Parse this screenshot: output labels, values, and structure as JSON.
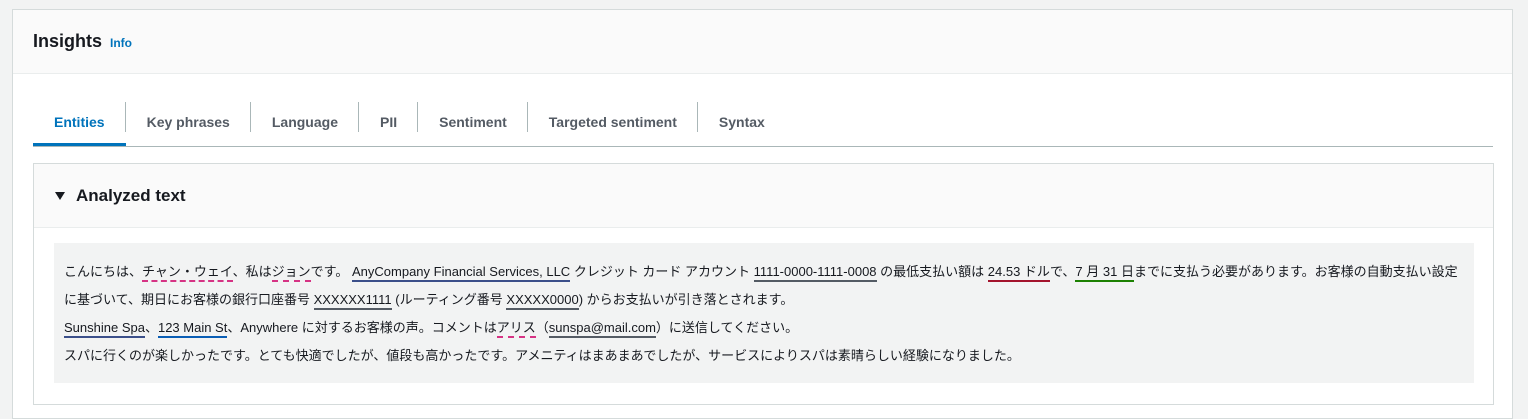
{
  "panel": {
    "title": "Insights",
    "info_label": "Info"
  },
  "tabs": [
    {
      "label": "Entities",
      "active": true
    },
    {
      "label": "Key phrases"
    },
    {
      "label": "Language"
    },
    {
      "label": "PII"
    },
    {
      "label": "Sentiment"
    },
    {
      "label": "Targeted sentiment"
    },
    {
      "label": "Syntax"
    }
  ],
  "analyzed": {
    "title": "Analyzed text",
    "p1": {
      "t0": "こんにちは、",
      "e0": "チャン・ウェイ",
      "t1": "、私は",
      "e1": "ジョン",
      "t2": "です。 ",
      "e2": "AnyCompany Financial Services, LLC",
      "t3": " クレジット カード アカウント ",
      "e3": "1111-0000-1111-0008",
      "t4": " の最低支払い額は ",
      "e4": "24.53 ドル",
      "t5": "で、",
      "e5": "7 月 31 日",
      "t6": "までに支払う必要があります。お客様の自動支払い設定に基づいて、期日にお客様の銀行口座番号 ",
      "e6": "XXXXXX1111",
      "t7": " (ルーティング番号 ",
      "e7": "XXXXX0000",
      "t8": ") からお支払いが引き落とされます。"
    },
    "p2": {
      "e0": "Sunshine Spa",
      "t0": "、",
      "e1": "123 Main St",
      "t1": "、Anywhere に対するお客様の声。コメントは",
      "e2": "アリス",
      "t2": "（",
      "e3": "sunspa@mail.com",
      "t3": "）に送信してください。"
    },
    "p3": "スパに行くのが楽しかったです。とても快適でしたが、値段も高かったです。アメニティはまあまあでしたが、サービスによりスパは素晴らしい経験になりました。"
  }
}
